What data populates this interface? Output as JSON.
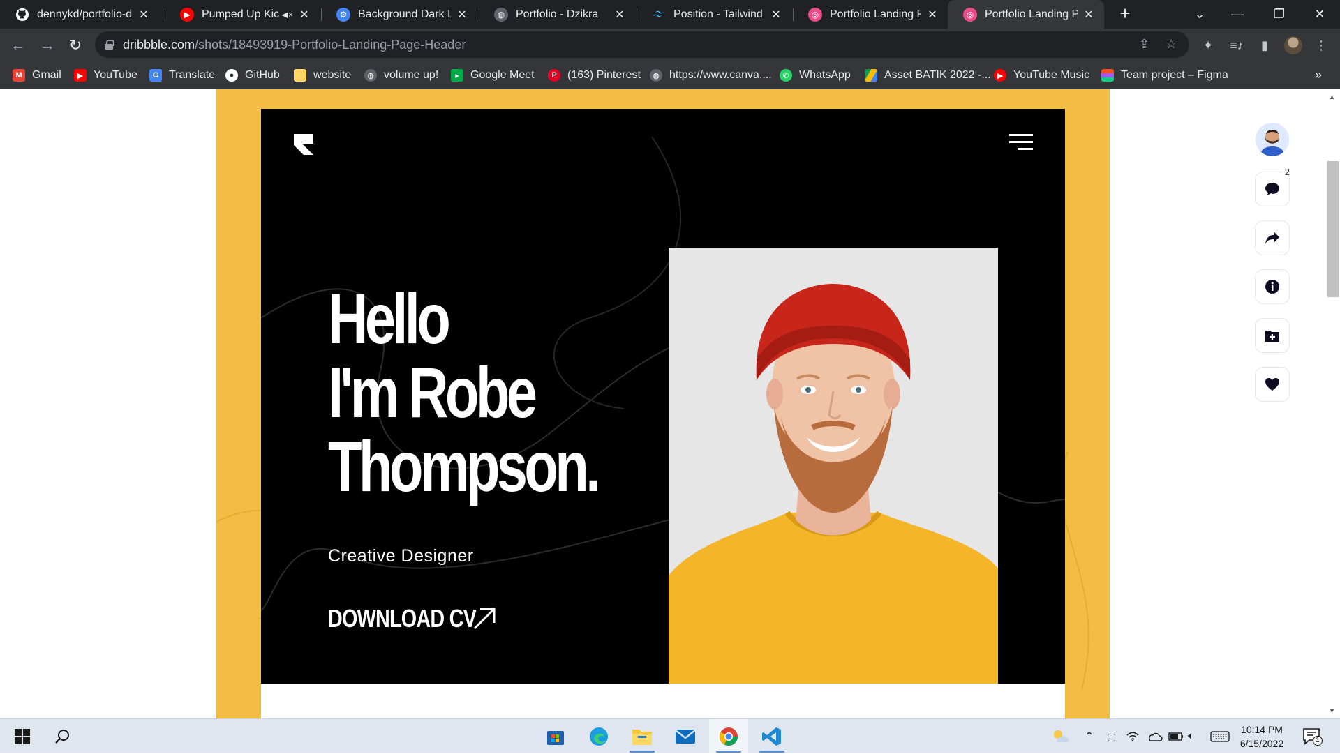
{
  "browser": {
    "tabs": [
      {
        "title": "dennykd/portfolio-dz",
        "icon": "github-icon",
        "color": "#ffffff"
      },
      {
        "title": "Pumped Up Kicks",
        "icon": "youtube-icon",
        "color": "#ff0000",
        "muted_indicator": true
      },
      {
        "title": "Background Dark Line",
        "icon": "gear-icon",
        "color": "#4285f4"
      },
      {
        "title": "Portfolio - Dzikra",
        "icon": "globe-icon",
        "color": "#9aa0a6"
      },
      {
        "title": "Position - Tailwind CS",
        "icon": "tailwind-icon",
        "color": "#38bdf8"
      },
      {
        "title": "Portfolio Landing Pag",
        "icon": "dribbble-icon",
        "color": "#ea4c89"
      },
      {
        "title": "Portfolio Landing Pag",
        "icon": "dribbble-icon",
        "color": "#ea4c89",
        "active": true
      }
    ],
    "url_host": "dribbble.com",
    "url_path": "/shots/18493919-Portfolio-Landing-Page-Header",
    "bookmarks": [
      {
        "label": "Gmail",
        "icon": "gmail-icon",
        "color": "#ea4335"
      },
      {
        "label": "YouTube",
        "icon": "youtube-icon",
        "color": "#ff0000"
      },
      {
        "label": "Translate",
        "icon": "translate-icon",
        "color": "#4285f4"
      },
      {
        "label": "GitHub",
        "icon": "github-icon",
        "color": "#ffffff"
      },
      {
        "label": "website",
        "icon": "folder-icon",
        "color": "#fdd663"
      },
      {
        "label": "volume up!",
        "icon": "globe-icon",
        "color": "#9aa0a6"
      },
      {
        "label": "Google Meet",
        "icon": "meet-icon",
        "color": "#00ac47"
      },
      {
        "label": "(163) Pinterest",
        "icon": "pinterest-icon",
        "color": "#e60023"
      },
      {
        "label": "https://www.canva....",
        "icon": "globe-icon",
        "color": "#9aa0a6"
      },
      {
        "label": "WhatsApp",
        "icon": "whatsapp-icon",
        "color": "#25d366"
      },
      {
        "label": "Asset BATIK 2022 -...",
        "icon": "drive-icon",
        "color": "#fbbc04"
      },
      {
        "label": "YouTube Music",
        "icon": "youtube-music-icon",
        "color": "#ff0000"
      },
      {
        "label": "Team project – Figma",
        "icon": "figma-icon",
        "color": "#f24e1e"
      }
    ]
  },
  "shot": {
    "headline": [
      "Hello",
      "I'm Robe",
      "Thompson."
    ],
    "role": "Creative Designer",
    "cta": "DOWNLOAD CV",
    "frame_color": "#f2bd42",
    "hero_bg": "#000000"
  },
  "rail": {
    "comment_count": "2",
    "actions": [
      "comment-icon",
      "share-icon",
      "info-icon",
      "add-to-collection-icon",
      "like-icon"
    ]
  },
  "taskbar": {
    "time": "10:14 PM",
    "date": "6/15/2022",
    "notification_count": "1"
  }
}
